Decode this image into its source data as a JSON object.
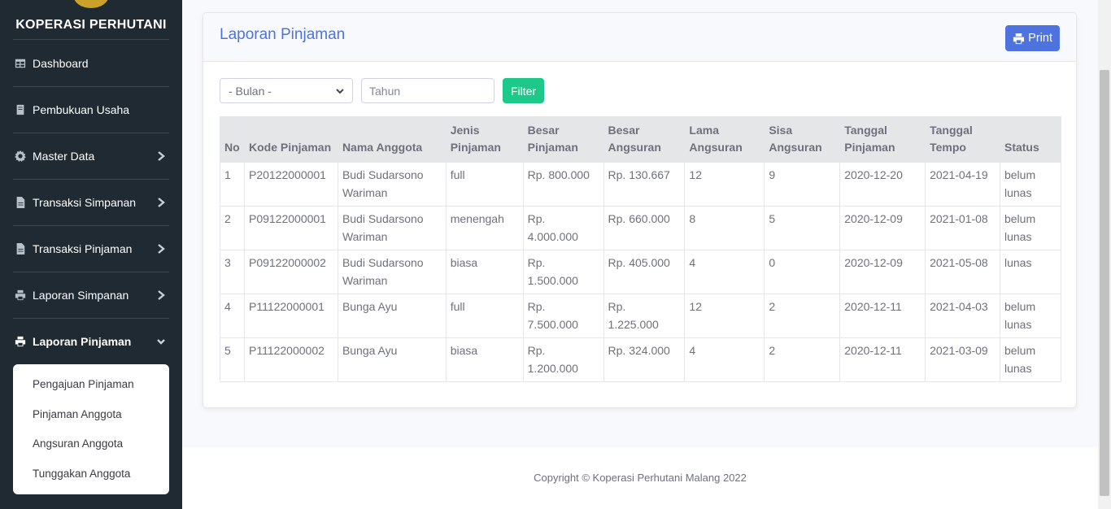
{
  "sidebar": {
    "brand": "KOPERASI PERHUTANI",
    "items": [
      {
        "label": "Dashboard",
        "icon": "table-icon"
      },
      {
        "label": "Pembukuan Usaha",
        "icon": "book-icon"
      },
      {
        "label": "Master Data",
        "icon": "gear-icon"
      },
      {
        "label": "Transaksi Simpanan",
        "icon": "file-icon"
      },
      {
        "label": "Transaksi Pinjaman",
        "icon": "file-icon"
      },
      {
        "label": "Laporan Simpanan",
        "icon": "print-icon"
      },
      {
        "label": "Laporan Pinjaman",
        "icon": "print-icon"
      }
    ],
    "submenu": [
      "Pengajuan Pinjaman",
      "Pinjaman Anggota",
      "Angsuran Anggota",
      "Tunggakan Anggota"
    ]
  },
  "page": {
    "title": "Laporan Pinjaman",
    "print_label": "Print"
  },
  "filter": {
    "month_selected": "- Bulan -",
    "year_placeholder": "Tahun",
    "button_label": "Filter"
  },
  "table": {
    "headers": [
      [
        "No"
      ],
      [
        "Kode Pinjaman"
      ],
      [
        "Nama Anggota"
      ],
      [
        "Jenis",
        "Pinjaman"
      ],
      [
        "Besar",
        "Pinjaman"
      ],
      [
        "Besar",
        "Angsuran"
      ],
      [
        "Lama",
        "Angsuran"
      ],
      [
        "Sisa",
        "Angsuran"
      ],
      [
        "Tanggal",
        "Pinjaman"
      ],
      [
        "Tanggal",
        "Tempo"
      ],
      [
        "Status"
      ]
    ],
    "rows": [
      [
        [
          "1"
        ],
        [
          "P20122000001"
        ],
        [
          "Budi Sudarsono",
          "Wariman"
        ],
        [
          "full"
        ],
        [
          "Rp. 800.000"
        ],
        [
          "Rp. 130.667"
        ],
        [
          "12"
        ],
        [
          "9"
        ],
        [
          "2020-12-20"
        ],
        [
          "2021-04-19"
        ],
        [
          "belum",
          "lunas"
        ]
      ],
      [
        [
          "2"
        ],
        [
          "P09122000001"
        ],
        [
          "Budi Sudarsono",
          "Wariman"
        ],
        [
          "menengah"
        ],
        [
          "Rp.",
          "4.000.000"
        ],
        [
          "Rp. 660.000"
        ],
        [
          "8"
        ],
        [
          "5"
        ],
        [
          "2020-12-09"
        ],
        [
          "2021-01-08"
        ],
        [
          "belum",
          "lunas"
        ]
      ],
      [
        [
          "3"
        ],
        [
          "P09122000002"
        ],
        [
          "Budi Sudarsono",
          "Wariman"
        ],
        [
          "biasa"
        ],
        [
          "Rp.",
          "1.500.000"
        ],
        [
          "Rp. 405.000"
        ],
        [
          "4"
        ],
        [
          "0"
        ],
        [
          "2020-12-09"
        ],
        [
          "2021-05-08"
        ],
        [
          "lunas"
        ]
      ],
      [
        [
          "4"
        ],
        [
          "P11122000001"
        ],
        [
          "Bunga Ayu"
        ],
        [
          "full"
        ],
        [
          "Rp.",
          "7.500.000"
        ],
        [
          "Rp.",
          "1.225.000"
        ],
        [
          "12"
        ],
        [
          "2"
        ],
        [
          "2020-12-11"
        ],
        [
          "2021-04-03"
        ],
        [
          "belum",
          "lunas"
        ]
      ],
      [
        [
          "5"
        ],
        [
          "P11122000002"
        ],
        [
          "Bunga Ayu"
        ],
        [
          "biasa"
        ],
        [
          "Rp.",
          "1.200.000"
        ],
        [
          "Rp. 324.000"
        ],
        [
          "4"
        ],
        [
          "2"
        ],
        [
          "2020-12-11"
        ],
        [
          "2021-03-09"
        ],
        [
          "belum",
          "lunas"
        ]
      ]
    ]
  },
  "footer": {
    "copyright": "Copyright © Koperasi Perhutani Malang 2022"
  },
  "colors": {
    "sidebar_bg": "#1f2a33",
    "accent": "#4e73df",
    "success": "#1cc88a",
    "text": "#6e707e"
  }
}
